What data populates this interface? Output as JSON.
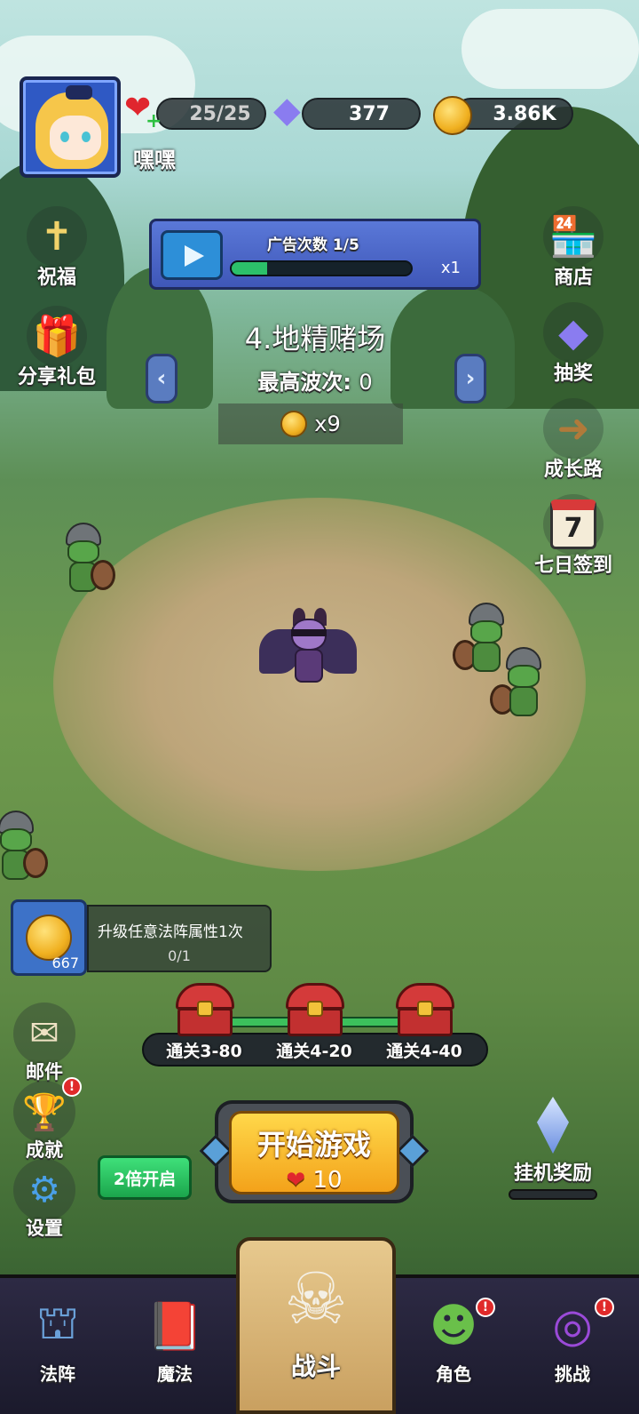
{
  "player": {
    "name": "嘿嘿"
  },
  "resources": {
    "hearts": "25/25",
    "gems": "377",
    "coins": "3.86K"
  },
  "ad": {
    "title": "广告次数 1/5",
    "progress": 0.2,
    "multiplier": "x1"
  },
  "side_left": [
    {
      "label": "祝福",
      "icon": "cross-icon"
    },
    {
      "label": "分享礼包",
      "icon": "gift-icon"
    }
  ],
  "side_right": [
    {
      "label": "商店",
      "icon": "shop-icon"
    },
    {
      "label": "抽奖",
      "icon": "crystal-icon"
    },
    {
      "label": "成长路",
      "icon": "signpost-icon"
    },
    {
      "label": "七日签到",
      "icon": "calendar-icon",
      "calendar_day": "7"
    }
  ],
  "level": {
    "name": "4.地精赌场",
    "best_wave_label": "最高波次:",
    "best_wave_value": "0",
    "reward": "x9"
  },
  "quest": {
    "coin_amount": "667",
    "text": "升级任意法阵属性1次",
    "progress": "0/1"
  },
  "chests": [
    "通关3-80",
    "通关4-20",
    "通关4-40"
  ],
  "buttons": {
    "mail": "邮件",
    "achievements": "成就",
    "settings": "设置",
    "double": "2倍开启",
    "start": "开始游戏",
    "start_cost": "10",
    "idle_reward": "挂机奖励"
  },
  "nav": [
    {
      "label": "法阵",
      "icon": "tower-icon"
    },
    {
      "label": "魔法",
      "icon": "spellbook-icon"
    },
    {
      "label": "战斗",
      "icon": "skull-swords-icon"
    },
    {
      "label": "角色",
      "icon": "orc-face-icon"
    },
    {
      "label": "挑战",
      "icon": "portal-icon"
    }
  ],
  "colors": {
    "accent": "#f3a21a",
    "badge": "#e02a2a",
    "progress": "#2cc06a",
    "panel": "#3f57b8"
  }
}
